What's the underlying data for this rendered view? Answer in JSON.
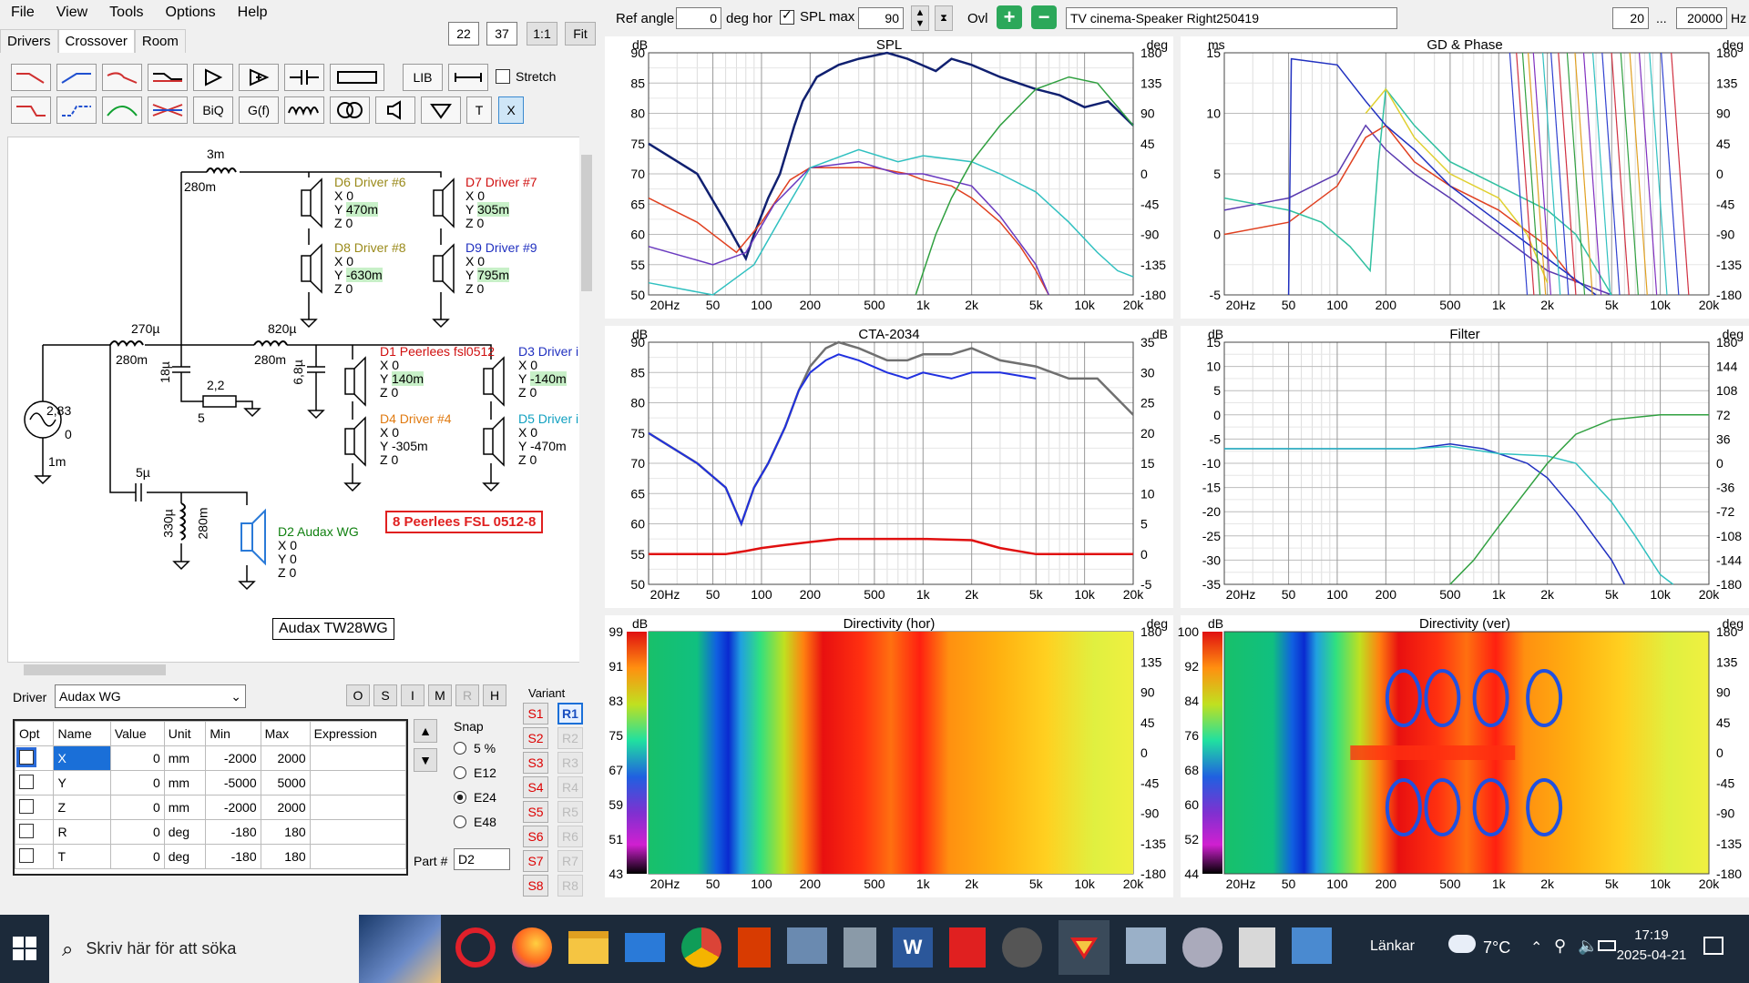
{
  "menu": [
    "File",
    "View",
    "Tools",
    "Options",
    "Help"
  ],
  "zoom": {
    "a": "22",
    "b": "37",
    "ratio": "1:1",
    "fit": "Fit"
  },
  "tabs": [
    "Drivers",
    "Crossover",
    "Room"
  ],
  "toolbar": {
    "lib": "LIB",
    "stretch": "Stretch",
    "biq": "BiQ",
    "gf": "G(f)",
    "t": "T",
    "x": "X"
  },
  "top": {
    "ref_angle_label": "Ref angle",
    "ref_angle": "0",
    "deg_hor": "deg hor",
    "spl_max_label": "SPL max",
    "spl_max": "90",
    "ovl": "Ovl",
    "project": "TV cinema-Speaker Right250419",
    "f_min": "20",
    "dots": "...",
    "f_max": "20000",
    "hz": "Hz"
  },
  "schematic": {
    "l1_top": "3m",
    "l1_bot": "280m",
    "l2_top": "270µ",
    "l2_bot": "280m",
    "l3_top": "820µ",
    "l3_bot": "280m",
    "c1": "18µ",
    "r1_top": "2,2",
    "r1_bot": "5",
    "c2": "6,8µ",
    "c3": "5µ",
    "l4_a": "330µ",
    "l4_b": "280m",
    "src_v": "2,83",
    "src_0": "0",
    "src_r": "1m",
    "drivers": [
      {
        "name": "D6 Driver #6",
        "x": "X 0",
        "y": "Y",
        "yv": "470m",
        "z": "Z 0",
        "color": "#9a8a1a"
      },
      {
        "name": "D7 Driver #7",
        "x": "X 0",
        "y": "Y",
        "yv": "305m",
        "z": "Z 0",
        "color": "#d01010"
      },
      {
        "name": "D8 Driver #8",
        "x": "X 0",
        "y": "Y",
        "yv": "-630m",
        "z": "Z 0",
        "color": "#9a8a1a"
      },
      {
        "name": "D9 Driver #9",
        "x": "X 0",
        "y": "Y",
        "yv": "795m",
        "z": "Z 0",
        "color": "#2030c0"
      },
      {
        "name": "D1 Peerlees fsl0512",
        "x": "X 0",
        "y": "Y",
        "yv": "140m",
        "z": "Z 0",
        "color": "#d01010"
      },
      {
        "name": "D3 Driver i",
        "x": "X 0",
        "y": "Y",
        "yv": "-140m",
        "z": "Z 0",
        "color": "#2030c0"
      },
      {
        "name": "D4 Driver #4",
        "x": "X 0",
        "y": "Y -305m",
        "yv": "",
        "z": "Z 0",
        "color": "#e07a10"
      },
      {
        "name": "D5 Driver i",
        "x": "X 0",
        "y": "Y -470m",
        "yv": "",
        "z": "Z 0",
        "color": "#10a0c0"
      },
      {
        "name": "D2 Audax WG",
        "x": "X 0",
        "y": "Y 0",
        "yv": "",
        "z": "Z 0",
        "color": "#108010"
      }
    ],
    "label_red": "8 Peerlees FSL 0512-8",
    "label_box": "Audax TW28WG"
  },
  "driver_sel": {
    "label": "Driver",
    "value": "Audax WG",
    "btns": [
      "O",
      "S",
      "I",
      "M",
      "R",
      "H"
    ]
  },
  "params": {
    "headers": [
      "Opt",
      "Name",
      "Value",
      "Unit",
      "Min",
      "Max",
      "Expression"
    ],
    "rows": [
      {
        "name": "X",
        "value": "0",
        "unit": "mm",
        "min": "-2000",
        "max": "2000"
      },
      {
        "name": "Y",
        "value": "0",
        "unit": "mm",
        "min": "-5000",
        "max": "5000"
      },
      {
        "name": "Z",
        "value": "0",
        "unit": "mm",
        "min": "-2000",
        "max": "2000"
      },
      {
        "name": "R",
        "value": "0",
        "unit": "deg",
        "min": "-180",
        "max": "180"
      },
      {
        "name": "T",
        "value": "0",
        "unit": "deg",
        "min": "-180",
        "max": "180"
      }
    ]
  },
  "snap": {
    "title": "Snap",
    "options": [
      "5 %",
      "E12",
      "E24",
      "E48"
    ],
    "selected": 2,
    "part_label": "Part #",
    "part": "D2"
  },
  "variant": {
    "title": "Variant",
    "s": [
      "S1",
      "S2",
      "S3",
      "S4",
      "S5",
      "S6",
      "S7",
      "S8"
    ],
    "r": [
      "R1",
      "R2",
      "R3",
      "R4",
      "R5",
      "R6",
      "R7",
      "R8"
    ]
  },
  "plots": {
    "freq_ticks": [
      "20Hz",
      "50",
      "100",
      "200",
      "500",
      "1k",
      "2k",
      "5k",
      "10k",
      "20k"
    ],
    "spl": {
      "title": "SPL",
      "unit_l": "dB",
      "unit_r": "deg",
      "yl": [
        "90",
        "85",
        "80",
        "75",
        "70",
        "65",
        "60",
        "55",
        "50"
      ],
      "yr": [
        "180",
        "135",
        "90",
        "45",
        "0",
        "-45",
        "-90",
        "-135",
        "-180"
      ]
    },
    "gd": {
      "title": "GD & Phase",
      "unit_l": "ms",
      "unit_r": "deg",
      "yl": [
        "15",
        "10",
        "5",
        "0",
        "-5"
      ],
      "yr": [
        "180",
        "135",
        "90",
        "45",
        "0",
        "-45",
        "-90",
        "-135",
        "-180"
      ]
    },
    "cta": {
      "title": "CTA-2034",
      "unit_l": "dB",
      "unit_r": "dB",
      "yl": [
        "90",
        "85",
        "80",
        "75",
        "70",
        "65",
        "60",
        "55",
        "50"
      ],
      "yr": [
        "35",
        "30",
        "25",
        "20",
        "15",
        "10",
        "5",
        "0",
        "-5"
      ]
    },
    "filter": {
      "title": "Filter",
      "unit_l": "dB",
      "unit_r": "deg",
      "yl": [
        "15",
        "10",
        "5",
        "0",
        "-5",
        "-10",
        "-15",
        "-20",
        "-25",
        "-30",
        "-35"
      ],
      "yr": [
        "180",
        "144",
        "108",
        "72",
        "36",
        "0",
        "-36",
        "-72",
        "-108",
        "-144",
        "-180"
      ]
    },
    "dirh": {
      "title": "Directivity (hor)",
      "unit_l": "dB",
      "unit_r": "deg",
      "scale": [
        "99",
        "91",
        "83",
        "75",
        "67",
        "59",
        "51",
        "43"
      ],
      "yr": [
        "180",
        "135",
        "90",
        "45",
        "0",
        "-45",
        "-90",
        "-135",
        "-180"
      ]
    },
    "dirv": {
      "title": "Directivity (ver)",
      "unit_l": "dB",
      "unit_r": "deg",
      "scale": [
        "100",
        "92",
        "84",
        "76",
        "68",
        "60",
        "52",
        "44"
      ],
      "yr": [
        "180",
        "135",
        "90",
        "45",
        "0",
        "-45",
        "-90",
        "-135",
        "-180"
      ]
    }
  },
  "taskbar": {
    "search": "Skriv här för att söka",
    "links": "Länkar",
    "temp": "7°C",
    "time": "17:19",
    "date": "2025-04-21"
  }
}
